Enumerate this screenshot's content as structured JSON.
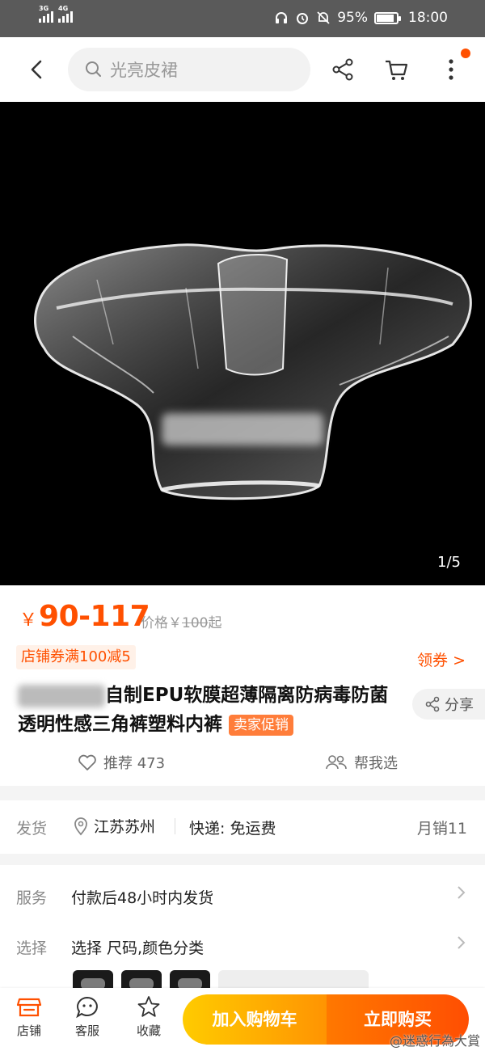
{
  "status_bar": {
    "network1": "3G",
    "network2": "4G",
    "battery_percent": "95%",
    "battery_level": 0.95,
    "time": "18:00"
  },
  "nav": {
    "search_placeholder": "光亮皮裙"
  },
  "hero": {
    "counter": "1/5"
  },
  "price": {
    "currency": "￥",
    "range": "90-117",
    "orig_label": "价格￥",
    "orig_value": "100",
    "orig_suffix": "起"
  },
  "coupon": {
    "label": "店铺券满100减5",
    "action": "领券 >"
  },
  "product": {
    "title": "自制EPU软膜超薄隔离防病毒防菌透明性感三角裤塑料内裤",
    "tag": "卖家促销",
    "share": "分享",
    "recommend": "推荐 473",
    "help_choose": "帮我选"
  },
  "shipping": {
    "label": "发货",
    "location": "江苏苏州",
    "express": "快递: 免运费",
    "monthly_sales": "月销11"
  },
  "services": {
    "service_label": "服务",
    "service_value": "付款后48小时内发货",
    "choose_label": "选择",
    "choose_value": "选择 尺码,颜色分类"
  },
  "bottom": {
    "store": "店铺",
    "support": "客服",
    "favorite": "收藏",
    "add_cart": "加入购物车",
    "buy_now": "立即购买"
  },
  "watermark": "@迷惑行為大賞",
  "colors": {
    "accent": "#ff5000",
    "cart_gradient": [
      "#ffcb00",
      "#ff9402"
    ],
    "buy_gradient": [
      "#ff7800",
      "#ff4e02"
    ]
  }
}
